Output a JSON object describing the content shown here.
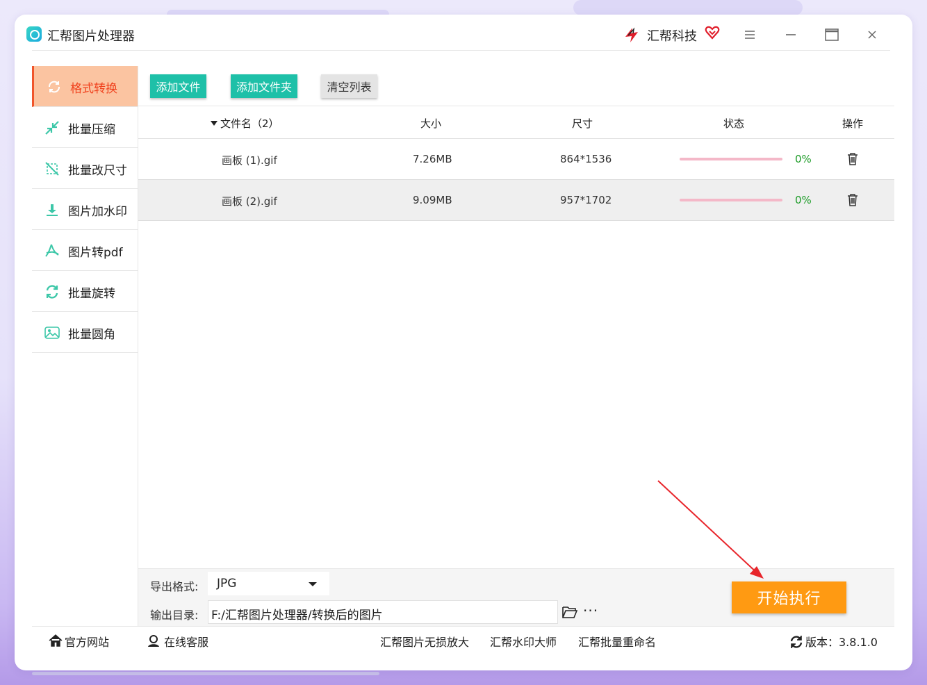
{
  "app": {
    "title": "汇帮图片处理器",
    "brand": "汇帮科技"
  },
  "toolbar": {
    "add_file": "添加文件",
    "add_folder": "添加文件夹",
    "clear_list": "清空列表"
  },
  "sidebar": {
    "items": [
      {
        "label": "格式转换",
        "icon": "convert-icon",
        "active": true
      },
      {
        "label": "批量压缩",
        "icon": "compress-icon"
      },
      {
        "label": "批量改尺寸",
        "icon": "resize-icon"
      },
      {
        "label": "图片加水印",
        "icon": "watermark-icon"
      },
      {
        "label": "图片转pdf",
        "icon": "pdf-icon"
      },
      {
        "label": "批量旋转",
        "icon": "rotate-icon"
      },
      {
        "label": "批量圆角",
        "icon": "rounded-corner-icon"
      }
    ]
  },
  "table": {
    "headers": {
      "name": "文件名（2）",
      "size": "大小",
      "dims": "尺寸",
      "status": "状态",
      "action": "操作"
    },
    "rows": [
      {
        "name": "画板 (1).gif",
        "size": "7.26MB",
        "dims": "864*1536",
        "progress": "0%"
      },
      {
        "name": "画板 (2).gif",
        "size": "9.09MB",
        "dims": "957*1702",
        "progress": "0%"
      }
    ]
  },
  "output": {
    "format_label": "导出格式:",
    "format_value": "JPG",
    "dir_label": "输出目录:",
    "dir_value": "F:/汇帮图片处理器/转换后的图片",
    "more": "···",
    "start_button": "开始执行"
  },
  "footer": {
    "official_site": "官方网站",
    "online_service": "在线客服",
    "link_enlarge": "汇帮图片无损放大",
    "link_watermark": "汇帮水印大师",
    "link_rename": "汇帮批量重命名",
    "version": "版本：3.8.1.0"
  },
  "colors": {
    "accent": "#1ec0a8",
    "active_bg": "#fbc4a1",
    "active_text": "#f0401c",
    "start": "#ff9a12",
    "progress": "#f4b8c8",
    "percent": "#1b9b26"
  }
}
